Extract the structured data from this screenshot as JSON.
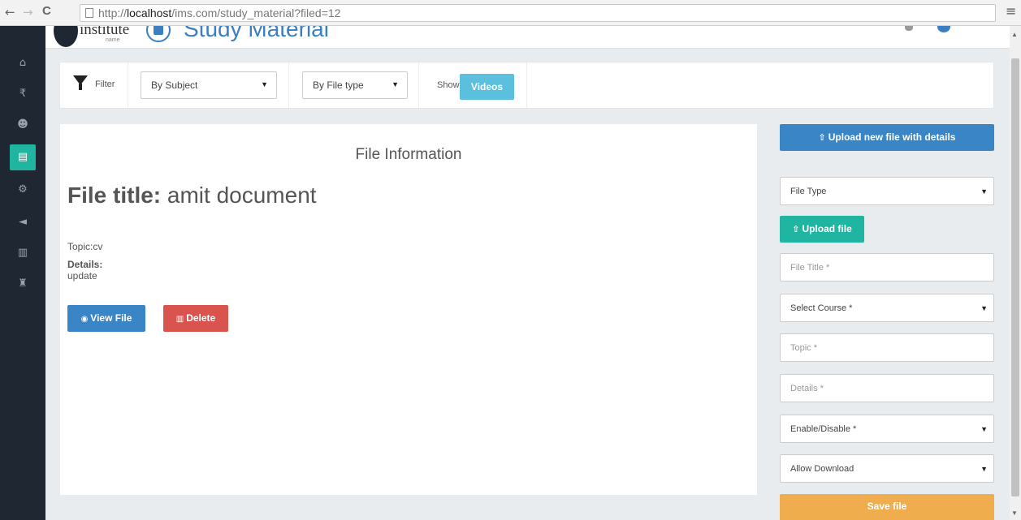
{
  "browser": {
    "back": "←",
    "forward": "→",
    "reload": "C",
    "url_prefix": "http://",
    "url_host": "localhost",
    "url_path": "/ims.com/study_material?filed=12",
    "menu": "≡"
  },
  "header": {
    "logo_text": "institute",
    "logo_sub": "name",
    "page_title": "Study Material"
  },
  "sidebar": {
    "items": [
      {
        "icon": "home-icon",
        "glyph": "⌂"
      },
      {
        "icon": "rupee-icon",
        "glyph": "₹"
      },
      {
        "icon": "users-icon",
        "glyph": "☻"
      },
      {
        "icon": "document-icon",
        "glyph": "▤",
        "active": true
      },
      {
        "icon": "gears-icon",
        "glyph": "⚙"
      },
      {
        "icon": "bullhorn-icon",
        "glyph": "◄"
      },
      {
        "icon": "bar-chart-icon",
        "glyph": "▥"
      },
      {
        "icon": "trophy-icon",
        "glyph": "♜"
      }
    ]
  },
  "filter": {
    "label": "Filter",
    "subject_select": "By Subject",
    "filetype_select": "By File type",
    "show_label": "Show:",
    "videos_button": "Videos"
  },
  "file_info": {
    "heading": "File Information",
    "title_label": "File title:",
    "title_value": " amit document",
    "topic": "Topic:cv",
    "details_label": "Details:",
    "details_value": "update",
    "view_button": "View File",
    "delete_button": "Delete"
  },
  "upload_form": {
    "upload_new_button": "Upload new file with details",
    "file_type_select": "File Type",
    "upload_file_button": "Upload file",
    "file_title_placeholder": "File Title *",
    "course_select": "Select Course *",
    "topic_placeholder": "Topic *",
    "details_placeholder": "Details *",
    "enable_select": "Enable/Disable *",
    "download_select": "Allow Download",
    "save_button": "Save file"
  },
  "colors": {
    "primary": "#3a85c6",
    "teal": "#1fb5a1",
    "danger": "#d9534f",
    "warning": "#f0ad4e",
    "info": "#5bc0de",
    "sidebar": "#1f2733"
  }
}
